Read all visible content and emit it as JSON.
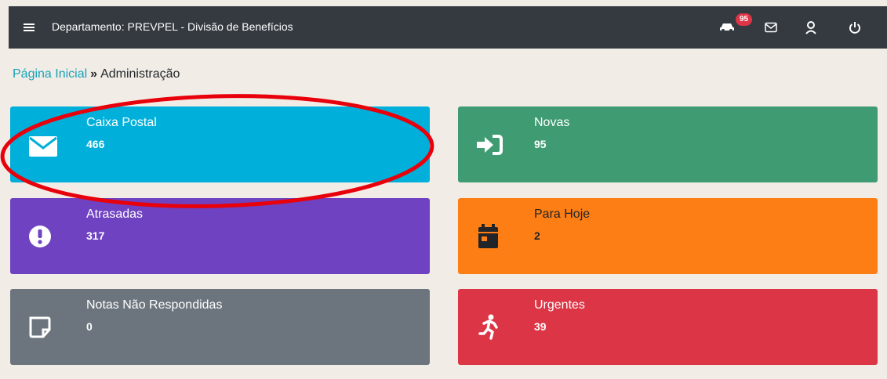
{
  "header": {
    "title": "Departamento: PREVPEL - Divisão de Benefícios",
    "notification_count": "95",
    "icons": [
      "menu-icon",
      "car-icon",
      "mail-icon",
      "user-icon",
      "power-icon"
    ]
  },
  "breadcrumb": {
    "home": "Página Inicial",
    "separator": "»",
    "current": "Administração"
  },
  "cards": [
    {
      "label": "Caixa Postal",
      "count": "466",
      "icon": "envelope-icon",
      "color": "#00b0da"
    },
    {
      "label": "Novas",
      "count": "95",
      "icon": "sign-in-icon",
      "color": "#3f9b72"
    },
    {
      "label": "Atrasadas",
      "count": "317",
      "icon": "exclamation-icon",
      "color": "#6f42c1"
    },
    {
      "label": "Para Hoje",
      "count": "2",
      "icon": "calendar-icon",
      "color": "#fd7e14"
    },
    {
      "label": "Notas Não Respondidas",
      "count": "0",
      "icon": "sticky-note-icon",
      "color": "#6c757d"
    },
    {
      "label": "Urgentes",
      "count": "39",
      "icon": "running-icon",
      "color": "#dc3545"
    }
  ],
  "annotation": {
    "shape": "ellipse",
    "color": "#e8000b",
    "target": "Caixa Postal"
  }
}
